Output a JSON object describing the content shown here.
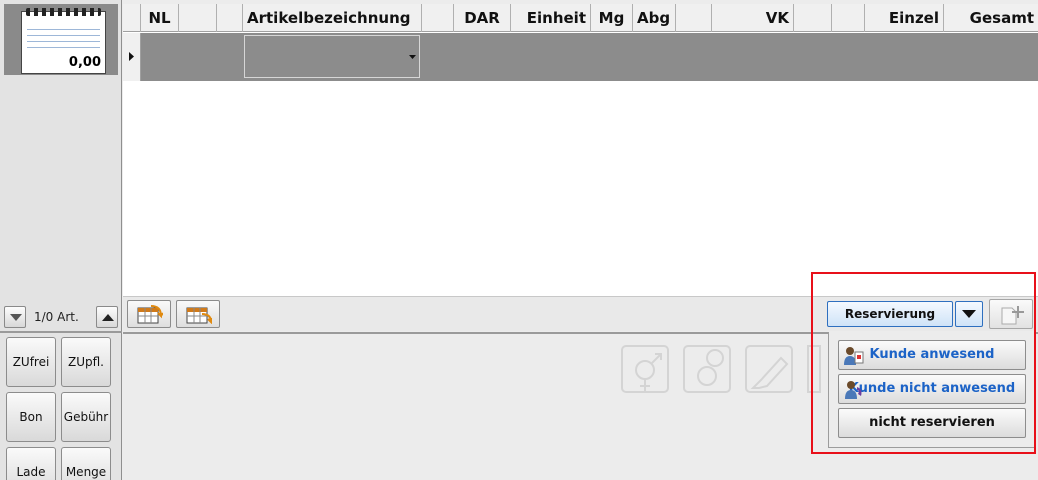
{
  "receipt": {
    "amount": "0,00"
  },
  "navigation": {
    "count_label": "1/0 Art."
  },
  "keys": [
    {
      "label": "ZUfrei"
    },
    {
      "label": "ZUpfl."
    },
    {
      "label": "Bon"
    },
    {
      "label": "Gebühr"
    },
    {
      "label": "Lade"
    },
    {
      "label": "Menge"
    }
  ],
  "grid": {
    "columns": [
      "NL",
      "",
      "",
      "Artikelbezeichnung",
      "",
      "DAR",
      "Einheit",
      "Mg",
      "Abg",
      "",
      "VK",
      "",
      "",
      "Einzel",
      "Gesamt"
    ],
    "rows": [
      {
        "article": ""
      }
    ]
  },
  "toolbar": {
    "reservation_label": "Reservierung"
  },
  "reservation_menu": {
    "items": [
      {
        "label": "Kunde anwesend",
        "icon": "customer-present-icon",
        "color": "#1c63c7"
      },
      {
        "label": "Kunde nicht anwesend",
        "icon": "customer-absent-phone-icon",
        "color": "#1c63c7"
      },
      {
        "label": "nicht reservieren",
        "icon": "",
        "color": "#111111"
      }
    ]
  },
  "colors": {
    "highlight": "#e8101a",
    "accent_blue": "#2e6fbf",
    "row_selected": "#8c8c8c"
  }
}
